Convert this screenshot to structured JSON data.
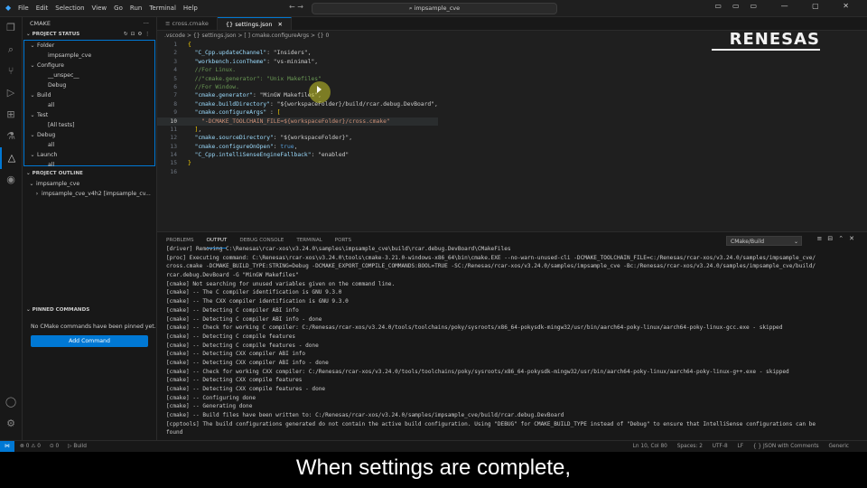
{
  "titlebar": {
    "menu": [
      "File",
      "Edit",
      "Selection",
      "View",
      "Go",
      "Run",
      "Terminal",
      "Help"
    ],
    "search": "impsample_cve"
  },
  "sidebar": {
    "title": "CMAKE",
    "project_status_header": "PROJECT STATUS",
    "status_tree": [
      {
        "label": "Folder",
        "level": 0,
        "chevron": "v"
      },
      {
        "label": "impsample_cve",
        "level": 1,
        "chevron": ""
      },
      {
        "label": "Configure",
        "level": 0,
        "chevron": "v"
      },
      {
        "label": "__unspec__",
        "level": 1,
        "chevron": ""
      },
      {
        "label": "Debug",
        "level": 1,
        "chevron": ""
      },
      {
        "label": "Build",
        "level": 0,
        "chevron": "v"
      },
      {
        "label": "all",
        "level": 1,
        "chevron": ""
      },
      {
        "label": "Test",
        "level": 0,
        "chevron": "v"
      },
      {
        "label": "[All tests]",
        "level": 1,
        "chevron": ""
      },
      {
        "label": "Debug",
        "level": 0,
        "chevron": "v"
      },
      {
        "label": "all",
        "level": 1,
        "chevron": ""
      },
      {
        "label": "Launch",
        "level": 0,
        "chevron": "v"
      },
      {
        "label": "all",
        "level": 1,
        "chevron": ""
      }
    ],
    "project_outline_header": "PROJECT OUTLINE",
    "outline_tree": [
      {
        "label": "impsample_cve",
        "level": 0,
        "chevron": "v"
      },
      {
        "label": "impsample_cve_v4h2 [impsample_cv...",
        "level": 1,
        "chevron": ">"
      }
    ],
    "pinned_header": "PINNED COMMANDS",
    "pinned_empty": "No CMake commands have been pinned yet.",
    "add_command": "Add Command"
  },
  "editor": {
    "tabs": [
      {
        "label": "cross.cmake",
        "active": false
      },
      {
        "label": "settings.json",
        "active": true
      }
    ],
    "breadcrumb": ".vscode > {} settings.json > [ ] cmake.configureArgs > {} 0",
    "current_line": 10
  },
  "code_lines": [
    "{",
    "  \"C_Cpp.updateChannel\": \"Insiders\",",
    "  \"workbench.iconTheme\": \"vs-minimal\",",
    "  //For Linux.",
    "  //\"cmake.generator\": \"Unix Makefiles\"",
    "  //For Window.",
    "  \"cmake.generator\": \"MinGW Makefiles\",",
    "  \"cmake.buildDirectory\": \"${workspaceFolder}/build/rcar.debug.DevBoard\",",
    "  \"cmake.configureArgs\" : [",
    "    \"-DCMAKE_TOOLCHAIN_FILE=${workspaceFolder}/cross.cmake\"",
    "  ],",
    "  \"cmake.sourceDirectory\": \"${workspaceFolder}\",",
    "  \"cmake.configureOnOpen\": true,",
    "  \"C_Cpp.intelliSenseEngineFallback\": \"enabled\"",
    "}",
    ""
  ],
  "brand": "RENESAS",
  "panel": {
    "tabs": [
      {
        "label": "PROBLEMS",
        "active": false
      },
      {
        "label": "OUTPUT",
        "active": true
      },
      {
        "label": "DEBUG CONSOLE",
        "active": false
      },
      {
        "label": "TERMINAL",
        "active": false
      },
      {
        "label": "PORTS",
        "active": false
      }
    ],
    "output_channel": "CMake/Build"
  },
  "output_lines": [
    "[driver] Removing C:\\Renesas\\rcar-xos\\v3.24.0\\samples\\impsample_cve\\build\\rcar.debug.DevBoard\\CMakeFiles",
    "[proc] Executing command: C:\\Renesas\\rcar-xos\\v3.24.0\\tools\\cmake-3.21.0-windows-x86_64\\bin\\cmake.EXE --no-warn-unused-cli -DCMAKE_TOOLCHAIN_FILE=c:/Renesas/rcar-xos/v3.24.0/samples/impsample_cve/",
    "cross.cmake -DCMAKE_BUILD_TYPE:STRING=Debug -DCMAKE_EXPORT_COMPILE_COMMANDS:BOOL=TRUE -SC:/Renesas/rcar-xos/v3.24.0/samples/impsample_cve -Bc:/Renesas/rcar-xos/v3.24.0/samples/impsample_cve/build/",
    "rcar.debug.DevBoard -G \"MinGW Makefiles\"",
    "[cmake] Not searching for unused variables given on the command line.",
    "[cmake] -- The C compiler identification is GNU 9.3.0",
    "[cmake] -- The CXX compiler identification is GNU 9.3.0",
    "[cmake] -- Detecting C compiler ABI info",
    "[cmake] -- Detecting C compiler ABI info - done",
    "[cmake] -- Check for working C compiler: C:/Renesas/rcar-xos/v3.24.0/tools/toolchains/poky/sysroots/x86_64-pokysdk-mingw32/usr/bin/aarch64-poky-linux/aarch64-poky-linux-gcc.exe - skipped",
    "[cmake] -- Detecting C compile features",
    "[cmake] -- Detecting C compile features - done",
    "[cmake] -- Detecting CXX compiler ABI info",
    "[cmake] -- Detecting CXX compiler ABI info - done",
    "[cmake] -- Check for working CXX compiler: C:/Renesas/rcar-xos/v3.24.0/tools/toolchains/poky/sysroots/x86_64-pokysdk-mingw32/usr/bin/aarch64-poky-linux/aarch64-poky-linux-g++.exe - skipped",
    "[cmake] -- Detecting CXX compile features",
    "[cmake] -- Detecting CXX compile features - done",
    "[cmake] -- Configuring done",
    "[cmake] -- Generating done",
    "[cmake] -- Build files have been written to: C:/Renesas/rcar-xos/v3.24.0/samples/impsample_cve/build/rcar.debug.DevBoard",
    "[cpptools] The build configurations generated do not contain the active build configuration. Using \"DEBUG\" for CMAKE_BUILD_TYPE instead of \"Debug\" to ensure that IntelliSense configurations can be",
    "found"
  ],
  "statusbar": {
    "left": [
      "⊗ 0 ⚠ 0",
      "⊙ 0",
      "▷ Build"
    ],
    "right": [
      "Ln 10, Col 80",
      "Spaces: 2",
      "UTF-8",
      "LF",
      "{ } JSON with Comments",
      "Generic"
    ]
  },
  "caption": "When settings are complete,"
}
